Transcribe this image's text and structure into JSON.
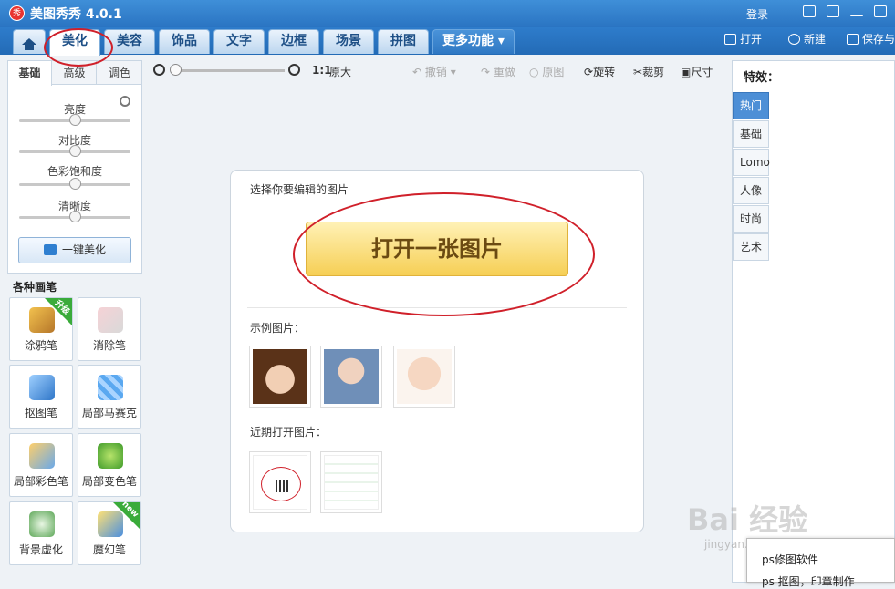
{
  "title_bar": {
    "app_logo": "秀",
    "app_title": "美图秀秀 4.0.1",
    "login": "登录",
    "icons": [
      "message-icon",
      "menu-icon",
      "minimize-icon",
      "maximize-icon"
    ]
  },
  "nav": {
    "home_icon": "home-icon",
    "tabs": [
      {
        "label": "美化",
        "active": true
      },
      {
        "label": "美容"
      },
      {
        "label": "饰品"
      },
      {
        "label": "文字"
      },
      {
        "label": "边框"
      },
      {
        "label": "场景"
      },
      {
        "label": "拼图"
      }
    ],
    "more_label": "更多功能 ▾",
    "actions": {
      "open": "打开",
      "new": "新建",
      "save": "保存与"
    }
  },
  "left_panel": {
    "subtabs": [
      "基础",
      "高级",
      "调色"
    ],
    "sliders": [
      {
        "label": "亮度",
        "value": 0.5
      },
      {
        "label": "对比度",
        "value": 0.5
      },
      {
        "label": "色彩饱和度",
        "value": 0.5
      },
      {
        "label": "清晰度",
        "value": 0.5
      }
    ],
    "one_click": "一键美化",
    "brushes_title": "各种画笔",
    "brushes": [
      {
        "label": "涂鸦笔",
        "icon": "paint-brush-icon",
        "badge": "升级"
      },
      {
        "label": "消除笔",
        "icon": "eraser-icon"
      },
      {
        "label": "抠图笔",
        "icon": "cutout-pen-icon"
      },
      {
        "label": "局部马赛克",
        "icon": "mosaic-icon"
      },
      {
        "label": "局部彩色笔",
        "icon": "color-brush-icon"
      },
      {
        "label": "局部变色笔",
        "icon": "recolor-brush-icon"
      },
      {
        "label": "背景虚化",
        "icon": "blur-background-icon"
      },
      {
        "label": "魔幻笔",
        "icon": "magic-pen-icon",
        "badge": "new"
      }
    ]
  },
  "toolbar": {
    "zoom_ratio": "1:1",
    "zoom_original": "原大",
    "undo": "撤销",
    "redo": "重做",
    "original": "原图",
    "rotate": "旋转",
    "crop": "裁剪",
    "size": "尺寸",
    "zoom_level": 0.0
  },
  "center": {
    "prompt": "选择你要编辑的图片",
    "open_button": "打开一张图片",
    "examples_label": "示例图片：",
    "recent_label": "近期打开图片："
  },
  "right_panel": {
    "title": "特效：",
    "tabs": [
      "热门",
      "基础",
      "Lomo",
      "人像",
      "时尚",
      "艺术"
    ]
  },
  "watermark": {
    "main": "Bai 经验",
    "sub": "jingyan.baidu.com"
  },
  "popup": {
    "items": [
      "ps修图软件",
      "ps 抠图，印章制作"
    ]
  },
  "colors": {
    "accent": "#2a74c2",
    "open_button": "#f6cf55",
    "annotation": "#d0202a"
  }
}
